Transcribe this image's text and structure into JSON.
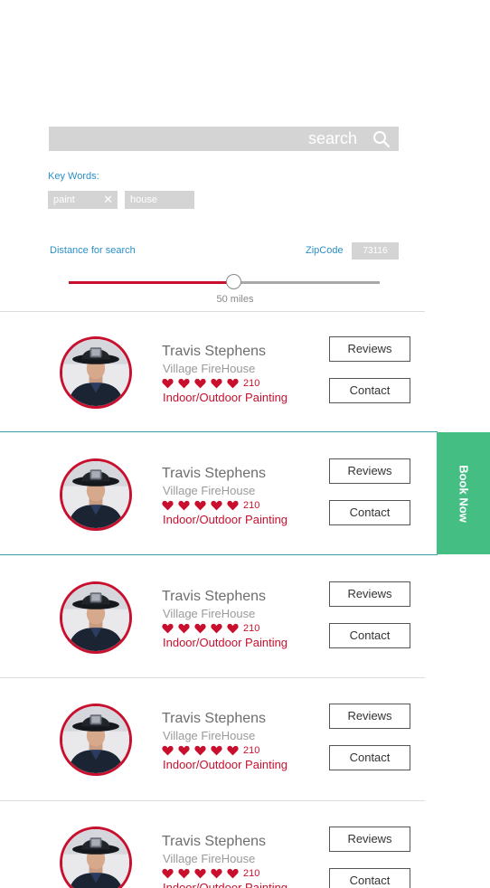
{
  "search": {
    "placeholder": "search",
    "icon": "search-icon"
  },
  "keywords": {
    "label": "Key Words:",
    "tags": [
      "paint",
      "house"
    ],
    "remove_glyph": "✕"
  },
  "distance": {
    "label": "Distance for search",
    "value_label": "50 miles",
    "fraction": 0.53
  },
  "zipcode": {
    "label": "ZipCode",
    "value": "73116"
  },
  "book_now": "Book Now",
  "results": [
    {
      "name": "Travis Stephens",
      "company": "Village FireHouse",
      "rating": 5,
      "count": "210",
      "service": "Indoor/Outdoor Painting",
      "reviews_label": "Reviews",
      "contact_label": "Contact"
    },
    {
      "name": "Travis Stephens",
      "company": "Village FireHouse",
      "rating": 5,
      "count": "210",
      "service": "Indoor/Outdoor Painting",
      "reviews_label": "Reviews",
      "contact_label": "Contact"
    },
    {
      "name": "Travis Stephens",
      "company": "Village FireHouse",
      "rating": 5,
      "count": "210",
      "service": "Indoor/Outdoor Painting",
      "reviews_label": "Reviews",
      "contact_label": "Contact"
    },
    {
      "name": "Travis Stephens",
      "company": "Village FireHouse",
      "rating": 5,
      "count": "210",
      "service": "Indoor/Outdoor Painting",
      "reviews_label": "Reviews",
      "contact_label": "Contact"
    },
    {
      "name": "Travis Stephens",
      "company": "Village FireHouse",
      "rating": 5,
      "count": "210",
      "service": "Indoor/Outdoor Painting",
      "reviews_label": "Reviews",
      "contact_label": "Contact"
    }
  ],
  "colors": {
    "accent": "#c8102e",
    "link": "#2a8fc9",
    "book_now": "#45be83",
    "selected_divider": "#3aa0a8"
  }
}
